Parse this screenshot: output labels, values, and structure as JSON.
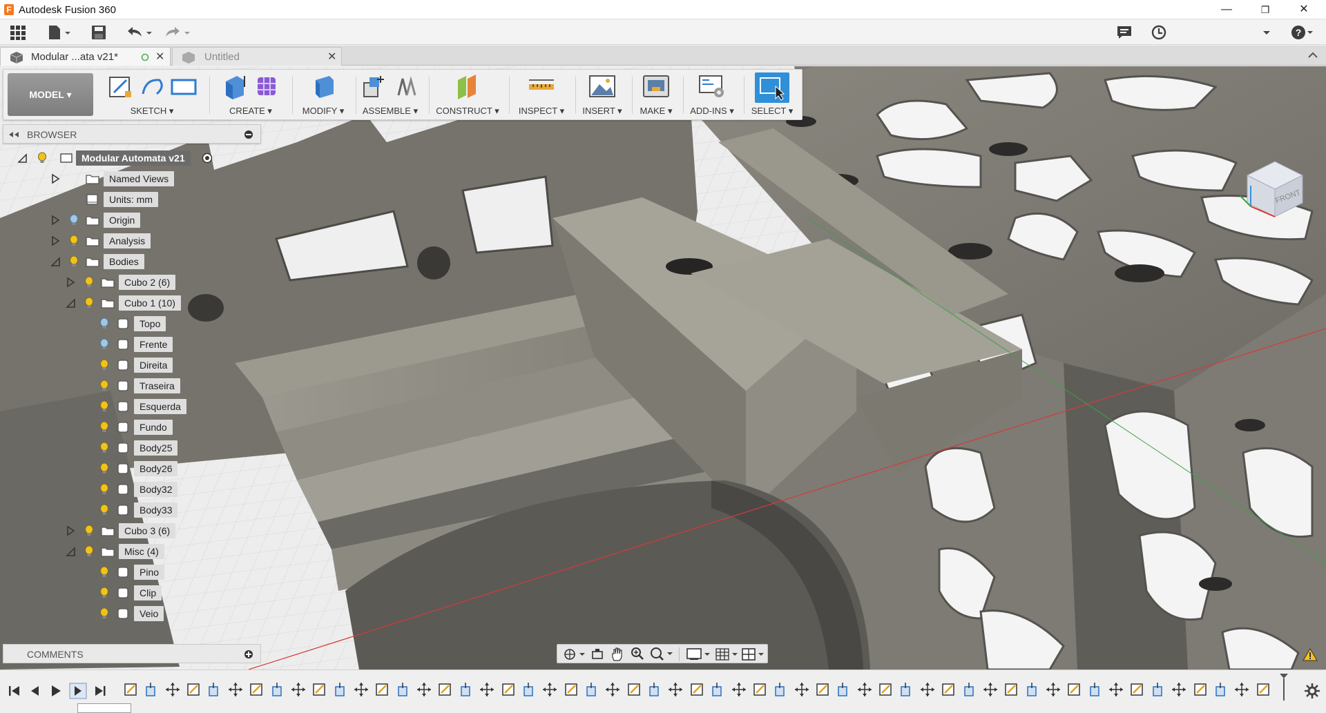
{
  "window": {
    "title": "Autodesk Fusion 360",
    "controls": {
      "minimize": "—",
      "restore": "❐",
      "close": "✕"
    }
  },
  "quick_access": {
    "icons": [
      "grid-menu-icon",
      "file-icon",
      "save-icon",
      "undo-icon",
      "redo-icon",
      "comment-icon",
      "clock-icon",
      "help-icon"
    ]
  },
  "tabs": [
    {
      "label": "Modular ...ata v21*",
      "active": true
    },
    {
      "label": "Untitled",
      "active": false
    }
  ],
  "toolbar": {
    "workspace": "MODEL ▾",
    "groups": [
      {
        "id": "sketch",
        "label": "SKETCH ▾"
      },
      {
        "id": "create",
        "label": "CREATE ▾"
      },
      {
        "id": "modify",
        "label": "MODIFY ▾"
      },
      {
        "id": "assemble",
        "label": "ASSEMBLE ▾"
      },
      {
        "id": "construct",
        "label": "CONSTRUCT ▾"
      },
      {
        "id": "inspect",
        "label": "INSPECT ▾"
      },
      {
        "id": "insert",
        "label": "INSERT ▾"
      },
      {
        "id": "make",
        "label": "MAKE ▾"
      },
      {
        "id": "addins",
        "label": "ADD-INS ▾"
      },
      {
        "id": "select",
        "label": "SELECT ▾"
      }
    ]
  },
  "browser": {
    "title": "BROWSER",
    "root": "Modular Automata v21",
    "nodes": [
      {
        "label": "Named Views",
        "level": 1,
        "expand": "closed",
        "bulb": false,
        "icon": "folder"
      },
      {
        "label": "Units: mm",
        "level": 1,
        "expand": "none",
        "bulb": false,
        "icon": "doc"
      },
      {
        "label": "Origin",
        "level": 1,
        "expand": "closed",
        "bulb": "off",
        "icon": "folder"
      },
      {
        "label": "Analysis",
        "level": 1,
        "expand": "closed",
        "bulb": "on",
        "icon": "folder"
      },
      {
        "label": "Bodies",
        "level": 1,
        "expand": "open",
        "bulb": "on",
        "icon": "folder"
      },
      {
        "label": "Cubo 2 (6)",
        "level": 2,
        "expand": "closed",
        "bulb": "on",
        "icon": "folder"
      },
      {
        "label": "Cubo 1 (10)",
        "level": 2,
        "expand": "open",
        "bulb": "on",
        "icon": "folder"
      },
      {
        "label": "Topo",
        "level": 3,
        "expand": "none",
        "bulb": "off",
        "icon": "body"
      },
      {
        "label": "Frente",
        "level": 3,
        "expand": "none",
        "bulb": "off",
        "icon": "body"
      },
      {
        "label": "Direita",
        "level": 3,
        "expand": "none",
        "bulb": "on",
        "icon": "body"
      },
      {
        "label": "Traseira",
        "level": 3,
        "expand": "none",
        "bulb": "on",
        "icon": "body"
      },
      {
        "label": "Esquerda",
        "level": 3,
        "expand": "none",
        "bulb": "on",
        "icon": "body"
      },
      {
        "label": "Fundo",
        "level": 3,
        "expand": "none",
        "bulb": "on",
        "icon": "body"
      },
      {
        "label": "Body25",
        "level": 3,
        "expand": "none",
        "bulb": "on",
        "icon": "body"
      },
      {
        "label": "Body26",
        "level": 3,
        "expand": "none",
        "bulb": "on",
        "icon": "body"
      },
      {
        "label": "Body32",
        "level": 3,
        "expand": "none",
        "bulb": "on",
        "icon": "body"
      },
      {
        "label": "Body33",
        "level": 3,
        "expand": "none",
        "bulb": "on",
        "icon": "body"
      },
      {
        "label": "Cubo 3 (6)",
        "level": 2,
        "expand": "closed",
        "bulb": "on",
        "icon": "folder"
      },
      {
        "label": "Misc (4)",
        "level": 2,
        "expand": "open",
        "bulb": "on",
        "icon": "folder"
      },
      {
        "label": "Pino",
        "level": 3,
        "expand": "none",
        "bulb": "on",
        "icon": "body"
      },
      {
        "label": "Clip",
        "level": 3,
        "expand": "none",
        "bulb": "on",
        "icon": "body"
      },
      {
        "label": "Veio",
        "level": 3,
        "expand": "none",
        "bulb": "on",
        "icon": "body"
      }
    ]
  },
  "comments": {
    "title": "COMMENTS"
  },
  "viewcube": {
    "face": "FRONT"
  },
  "timeline": {
    "controls": [
      "skip-start-icon",
      "step-back-icon",
      "play-icon",
      "step-forward-icon",
      "skip-end-icon"
    ],
    "feature_count": 55
  },
  "colors": {
    "accent": "#2f8fd8",
    "bulb_on": "#f2c21b",
    "bulb_off": "#9fc8e8",
    "model_surface": "#7c7a73",
    "grid_bg": "#ededed"
  }
}
